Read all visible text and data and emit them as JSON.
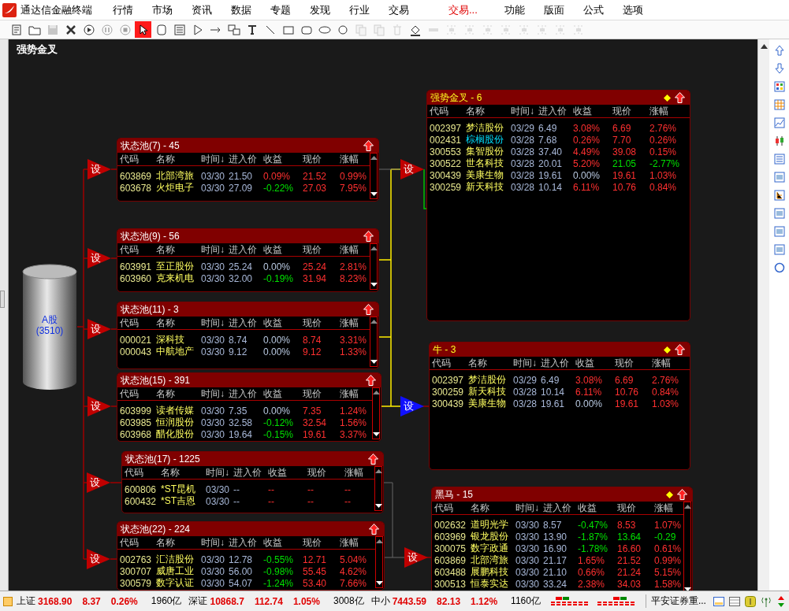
{
  "app": {
    "title": "通达信金融终端"
  },
  "menu": [
    {
      "label": "行情",
      "highlighted": false
    },
    {
      "label": "市场",
      "highlighted": false
    },
    {
      "label": "资讯",
      "highlighted": false
    },
    {
      "label": "数据",
      "highlighted": false
    },
    {
      "label": "专题",
      "highlighted": false
    },
    {
      "label": "发现",
      "highlighted": false
    },
    {
      "label": "行业",
      "highlighted": false
    },
    {
      "label": "交易",
      "highlighted": false
    },
    {
      "label": "交易...",
      "highlighted": true
    },
    {
      "label": "功能",
      "highlighted": false
    },
    {
      "label": "版面",
      "highlighted": false
    },
    {
      "label": "公式",
      "highlighted": false
    },
    {
      "label": "选项",
      "highlighted": false
    }
  ],
  "toolbar": [
    {
      "kind": "page",
      "selected": false,
      "disabled": false
    },
    {
      "kind": "folder",
      "selected": false,
      "disabled": false
    },
    {
      "kind": "save",
      "selected": false,
      "disabled": true
    },
    {
      "kind": "close",
      "selected": false,
      "disabled": false
    },
    {
      "kind": "play",
      "selected": false,
      "disabled": false
    },
    {
      "kind": "pause",
      "selected": false,
      "disabled": true
    },
    {
      "kind": "stop",
      "selected": false,
      "disabled": true
    },
    {
      "kind": "pointer",
      "selected": true,
      "disabled": false
    },
    {
      "kind": "node",
      "selected": false,
      "disabled": false
    },
    {
      "kind": "list",
      "selected": false,
      "disabled": false
    },
    {
      "kind": "triangle",
      "selected": false,
      "disabled": false
    },
    {
      "kind": "arrow",
      "selected": false,
      "disabled": false
    },
    {
      "kind": "link",
      "selected": false,
      "disabled": false
    },
    {
      "kind": "text",
      "selected": false,
      "disabled": false
    },
    {
      "kind": "line",
      "selected": false,
      "disabled": false
    },
    {
      "kind": "rect",
      "selected": false,
      "disabled": false
    },
    {
      "kind": "rrect",
      "selected": false,
      "disabled": false
    },
    {
      "kind": "ellipse",
      "selected": false,
      "disabled": false
    },
    {
      "kind": "circle",
      "selected": false,
      "disabled": false
    },
    {
      "kind": "copy",
      "selected": false,
      "disabled": true
    },
    {
      "kind": "copy",
      "selected": false,
      "disabled": true
    },
    {
      "kind": "delete",
      "selected": false,
      "disabled": true
    },
    {
      "kind": "fill",
      "selected": false,
      "disabled": false
    },
    {
      "kind": "bar",
      "selected": false,
      "disabled": true
    },
    {
      "kind": "align",
      "selected": false,
      "disabled": true
    },
    {
      "kind": "align",
      "selected": false,
      "disabled": true
    },
    {
      "kind": "align",
      "selected": false,
      "disabled": true
    },
    {
      "kind": "align",
      "selected": false,
      "disabled": true
    },
    {
      "kind": "align",
      "selected": false,
      "disabled": true
    },
    {
      "kind": "align",
      "selected": false,
      "disabled": true
    },
    {
      "kind": "align",
      "selected": false,
      "disabled": true
    },
    {
      "kind": "align",
      "selected": false,
      "disabled": true
    }
  ],
  "page_title": "强势金叉",
  "source": {
    "label": "A股",
    "count": "(3510)"
  },
  "panels": [
    {
      "kind": "pool",
      "title": "状态池(7) - 45",
      "highlighted": false,
      "scrollable": true,
      "trigger": {
        "label": "设",
        "selected": false
      },
      "columns": [
        "代码",
        "名称",
        "时间↓",
        "进入价",
        "收益",
        "现价",
        "涨幅"
      ],
      "rows": [
        {
          "code": "603869",
          "name": "北部湾旅",
          "time": "03/30",
          "entry": "21.50",
          "gain": {
            "text": "0.09%",
            "color": "#ff3030"
          },
          "price": {
            "text": "21.52",
            "color": "#ff3030"
          },
          "change": {
            "text": "0.99%",
            "color": "#ff3030"
          },
          "marked": false
        },
        {
          "code": "603678",
          "name": "火炬电子",
          "time": "03/30",
          "entry": "27.09",
          "gain": {
            "text": "-0.22%",
            "color": "#00e000"
          },
          "price": {
            "text": "27.03",
            "color": "#ff3030"
          },
          "change": {
            "text": "7.95%",
            "color": "#ff3030"
          },
          "marked": false
        }
      ]
    },
    {
      "kind": "pool",
      "title": "状态池(9) - 56",
      "highlighted": false,
      "scrollable": true,
      "trigger": {
        "label": "设",
        "selected": false
      },
      "columns": [
        "代码",
        "名称",
        "时间↓",
        "进入价",
        "收益",
        "现价",
        "涨幅"
      ],
      "rows": [
        {
          "code": "603991",
          "name": "至正股份",
          "time": "03/30",
          "entry": "25.24",
          "gain": {
            "text": "0.00%",
            "color": "#b8c8e0"
          },
          "price": {
            "text": "25.24",
            "color": "#ff3030"
          },
          "change": {
            "text": "2.81%",
            "color": "#ff3030"
          },
          "marked": false
        },
        {
          "code": "603960",
          "name": "克来机电",
          "time": "03/30",
          "entry": "32.00",
          "gain": {
            "text": "-0.19%",
            "color": "#00e000"
          },
          "price": {
            "text": "31.94",
            "color": "#ff3030"
          },
          "change": {
            "text": "8.23%",
            "color": "#ff3030"
          },
          "marked": false
        }
      ]
    },
    {
      "kind": "pool",
      "title": "状态池(11) - 3",
      "highlighted": false,
      "scrollable": true,
      "trigger": {
        "label": "设",
        "selected": false
      },
      "columns": [
        "代码",
        "名称",
        "时间↓",
        "进入价",
        "收益",
        "现价",
        "涨幅"
      ],
      "rows": [
        {
          "code": "000021",
          "name": "深科技",
          "time": "03/30",
          "entry": "8.74",
          "gain": {
            "text": "0.00%",
            "color": "#b8c8e0"
          },
          "price": {
            "text": "8.74",
            "color": "#ff3030"
          },
          "change": {
            "text": "3.31%",
            "color": "#ff3030"
          },
          "marked": false
        },
        {
          "code": "000043",
          "name": "中航地产",
          "time": "03/30",
          "entry": "9.12",
          "gain": {
            "text": "0.00%",
            "color": "#b8c8e0"
          },
          "price": {
            "text": "9.12",
            "color": "#ff3030"
          },
          "change": {
            "text": "1.33%",
            "color": "#ff3030"
          },
          "marked": false
        }
      ]
    },
    {
      "kind": "pool",
      "title": "状态池(15) - 391",
      "highlighted": false,
      "scrollable": true,
      "trigger": {
        "label": "设",
        "selected": false
      },
      "columns": [
        "代码",
        "名称",
        "时间↓",
        "进入价",
        "收益",
        "现价",
        "涨幅"
      ],
      "rows": [
        {
          "code": "603999",
          "name": "读者传媒",
          "time": "03/30",
          "entry": "7.35",
          "gain": {
            "text": "0.00%",
            "color": "#b8c8e0"
          },
          "price": {
            "text": "7.35",
            "color": "#ff3030"
          },
          "change": {
            "text": "1.24%",
            "color": "#ff3030"
          },
          "marked": false
        },
        {
          "code": "603985",
          "name": "恒润股份",
          "time": "03/30",
          "entry": "32.58",
          "gain": {
            "text": "-0.12%",
            "color": "#00e000"
          },
          "price": {
            "text": "32.54",
            "color": "#ff3030"
          },
          "change": {
            "text": "1.56%",
            "color": "#ff3030"
          },
          "marked": false
        },
        {
          "code": "603968",
          "name": "醋化股份",
          "time": "03/30",
          "entry": "19.64",
          "gain": {
            "text": "-0.15%",
            "color": "#00e000"
          },
          "price": {
            "text": "19.61",
            "color": "#ff3030"
          },
          "change": {
            "text": "3.37%",
            "color": "#ff3030"
          },
          "marked": false
        }
      ]
    },
    {
      "kind": "pool",
      "title": "状态池(17) - 1225",
      "highlighted": false,
      "scrollable": true,
      "trigger": {
        "label": "设",
        "selected": false
      },
      "columns": [
        "代码",
        "名称",
        "时间↓",
        "进入价",
        "收益",
        "现价",
        "涨幅"
      ],
      "rows": [
        {
          "code": "600806",
          "name": "*ST昆机",
          "time": "03/30",
          "entry": "--",
          "gain": {
            "text": "--"
          },
          "price": {
            "text": "--"
          },
          "change": {
            "text": "--"
          },
          "marked": false
        },
        {
          "code": "600432",
          "name": "*ST吉恩",
          "time": "03/30",
          "entry": "--",
          "gain": {
            "text": "--"
          },
          "price": {
            "text": "--"
          },
          "change": {
            "text": "--"
          },
          "marked": false
        }
      ]
    },
    {
      "kind": "pool",
      "title": "状态池(22) - 224",
      "highlighted": false,
      "scrollable": true,
      "trigger": {
        "label": "设",
        "selected": false
      },
      "columns": [
        "代码",
        "名称",
        "时间↓",
        "进入价",
        "收益",
        "现价",
        "涨幅"
      ],
      "rows": [
        {
          "code": "002763",
          "name": "汇洁股份",
          "time": "03/30",
          "entry": "12.78",
          "gain": {
            "text": "-0.55%",
            "color": "#00e000"
          },
          "price": {
            "text": "12.71",
            "color": "#ff3030"
          },
          "change": {
            "text": "5.04%",
            "color": "#ff3030"
          },
          "marked": false
        },
        {
          "code": "300707",
          "name": "威唐工业",
          "time": "03/30",
          "entry": "56.00",
          "gain": {
            "text": "-0.98%",
            "color": "#00e000"
          },
          "price": {
            "text": "55.45",
            "color": "#ff3030"
          },
          "change": {
            "text": "4.62%",
            "color": "#ff3030"
          },
          "marked": false
        },
        {
          "code": "300579",
          "name": "数字认证",
          "time": "03/30",
          "entry": "54.07",
          "gain": {
            "text": "-1.24%",
            "color": "#00e000"
          },
          "price": {
            "text": "53.40",
            "color": "#ff3030"
          },
          "change": {
            "text": "7.66%",
            "color": "#ff3030"
          },
          "marked": false
        }
      ]
    },
    {
      "kind": "target",
      "title": "强势金叉 - 6",
      "highlighted": true,
      "scrollable": false,
      "trigger": {
        "label": "设",
        "selected": false
      },
      "columns": [
        "代码",
        "名称",
        "时间↓",
        "进入价",
        "收益",
        "现价",
        "涨幅"
      ],
      "rows": [
        {
          "code": "002397",
          "name": "梦洁股份",
          "time": "03/29",
          "entry": "6.49",
          "gain": {
            "text": "3.08%",
            "color": "#ff3030"
          },
          "price": {
            "text": "6.69",
            "color": "#ff3030"
          },
          "change": {
            "text": "2.76%",
            "color": "#ff3030"
          },
          "marked": false
        },
        {
          "code": "002431",
          "name": "棕榈股份",
          "time": "03/28",
          "entry": "7.68",
          "gain": {
            "text": "0.26%",
            "color": "#ff3030"
          },
          "price": {
            "text": "7.70",
            "color": "#ff3030"
          },
          "change": {
            "text": "0.26%",
            "color": "#ff3030"
          },
          "marked": true
        },
        {
          "code": "300553",
          "name": "集智股份",
          "time": "03/28",
          "entry": "37.40",
          "gain": {
            "text": "4.49%",
            "color": "#ff3030"
          },
          "price": {
            "text": "39.08",
            "color": "#ff3030"
          },
          "change": {
            "text": "0.15%",
            "color": "#ff3030"
          },
          "marked": false
        },
        {
          "code": "300522",
          "name": "世名科技",
          "time": "03/28",
          "entry": "20.01",
          "gain": {
            "text": "5.20%",
            "color": "#ff3030"
          },
          "price": {
            "text": "21.05",
            "color": "#00e000"
          },
          "change": {
            "text": "-2.77%",
            "color": "#00e000"
          },
          "marked": false
        },
        {
          "code": "300439",
          "name": "美康生物",
          "time": "03/28",
          "entry": "19.61",
          "gain": {
            "text": "0.00%",
            "color": "#b8c8e0"
          },
          "price": {
            "text": "19.61",
            "color": "#ff3030"
          },
          "change": {
            "text": "1.03%",
            "color": "#ff3030"
          },
          "marked": false
        },
        {
          "code": "300259",
          "name": "新天科技",
          "time": "03/28",
          "entry": "10.14",
          "gain": {
            "text": "6.11%",
            "color": "#ff3030"
          },
          "price": {
            "text": "10.76",
            "color": "#ff3030"
          },
          "change": {
            "text": "0.84%",
            "color": "#ff3030"
          },
          "marked": false
        }
      ]
    },
    {
      "kind": "target",
      "title": "牛 - 3",
      "highlighted": true,
      "scrollable": false,
      "trigger": {
        "label": "设",
        "selected": true
      },
      "columns": [
        "代码",
        "名称",
        "时间↓",
        "进入价",
        "收益",
        "现价",
        "涨幅"
      ],
      "rows": [
        {
          "code": "002397",
          "name": "梦洁股份",
          "time": "03/29",
          "entry": "6.49",
          "gain": {
            "text": "3.08%",
            "color": "#ff3030"
          },
          "price": {
            "text": "6.69",
            "color": "#ff3030"
          },
          "change": {
            "text": "2.76%",
            "color": "#ff3030"
          },
          "marked": false
        },
        {
          "code": "300259",
          "name": "新天科技",
          "time": "03/28",
          "entry": "10.14",
          "gain": {
            "text": "6.11%",
            "color": "#ff3030"
          },
          "price": {
            "text": "10.76",
            "color": "#ff3030"
          },
          "change": {
            "text": "0.84%",
            "color": "#ff3030"
          },
          "marked": false
        },
        {
          "code": "300439",
          "name": "美康生物",
          "time": "03/28",
          "entry": "19.61",
          "gain": {
            "text": "0.00%",
            "color": "#b8c8e0"
          },
          "price": {
            "text": "19.61",
            "color": "#ff3030"
          },
          "change": {
            "text": "1.03%",
            "color": "#ff3030"
          },
          "marked": false
        }
      ]
    },
    {
      "kind": "target",
      "title": "黑马 - 15",
      "highlighted": false,
      "scrollable": true,
      "trigger": {
        "label": "设",
        "selected": false
      },
      "columns": [
        "代码",
        "名称",
        "时间↓",
        "进入价",
        "收益",
        "现价",
        "涨幅"
      ],
      "rows": [
        {
          "code": "002632",
          "name": "道明光学",
          "time": "03/30",
          "entry": "8.57",
          "gain": {
            "text": "-0.47%",
            "color": "#00e000"
          },
          "price": {
            "text": "8.53",
            "color": "#ff3030"
          },
          "change": {
            "text": "1.07%",
            "color": "#ff3030"
          },
          "marked": false
        },
        {
          "code": "603969",
          "name": "银龙股份",
          "time": "03/30",
          "entry": "13.90",
          "gain": {
            "text": "-1.87%",
            "color": "#00e000"
          },
          "price": {
            "text": "13.64",
            "color": "#00e000"
          },
          "change": {
            "text": "-0.29",
            "color": "#00e000"
          },
          "marked": false
        },
        {
          "code": "300075",
          "name": "数字政通",
          "time": "03/30",
          "entry": "16.90",
          "gain": {
            "text": "-1.78%",
            "color": "#00e000"
          },
          "price": {
            "text": "16.60",
            "color": "#ff3030"
          },
          "change": {
            "text": "0.61%",
            "color": "#ff3030"
          },
          "marked": false
        },
        {
          "code": "603869",
          "name": "北部湾旅",
          "time": "03/30",
          "entry": "21.17",
          "gain": {
            "text": "1.65%",
            "color": "#ff3030"
          },
          "price": {
            "text": "21.52",
            "color": "#ff3030"
          },
          "change": {
            "text": "0.99%",
            "color": "#ff3030"
          },
          "marked": false
        },
        {
          "code": "603488",
          "name": "展鹏科技",
          "time": "03/30",
          "entry": "21.10",
          "gain": {
            "text": "0.66%",
            "color": "#ff3030"
          },
          "price": {
            "text": "21.24",
            "color": "#ff3030"
          },
          "change": {
            "text": "5.15%",
            "color": "#ff3030"
          },
          "marked": false
        },
        {
          "code": "300513",
          "name": "恒泰实达",
          "time": "03/30",
          "entry": "33.24",
          "gain": {
            "text": "2.38%",
            "color": "#ff3030"
          },
          "price": {
            "text": "34.03",
            "color": "#ff3030"
          },
          "change": {
            "text": "1.58%",
            "color": "#ff3030"
          },
          "marked": false
        }
      ]
    }
  ],
  "sidebar": [
    {
      "kind": "up"
    },
    {
      "kind": "down"
    },
    {
      "kind": "grid"
    },
    {
      "kind": "table"
    },
    {
      "kind": "chart"
    },
    {
      "kind": "candle"
    },
    {
      "kind": "list"
    },
    {
      "kind": "doc"
    },
    {
      "kind": "tree"
    },
    {
      "kind": "doc"
    },
    {
      "kind": "doc"
    },
    {
      "kind": "doc"
    },
    {
      "kind": "circle"
    }
  ],
  "status_bar": {
    "indices": [
      {
        "name": "上证",
        "value": "3168.90",
        "change": "8.37",
        "percent": "0.26%",
        "amount": "1960亿"
      },
      {
        "name": "深证",
        "value": "10868.7",
        "change": "112.74",
        "percent": "1.05%",
        "amount": "3008亿"
      },
      {
        "name": "中小",
        "value": "7443.59",
        "change": "82.13",
        "percent": "1.12%",
        "amount": "1160亿"
      }
    ],
    "broker": "平安证券重..."
  }
}
